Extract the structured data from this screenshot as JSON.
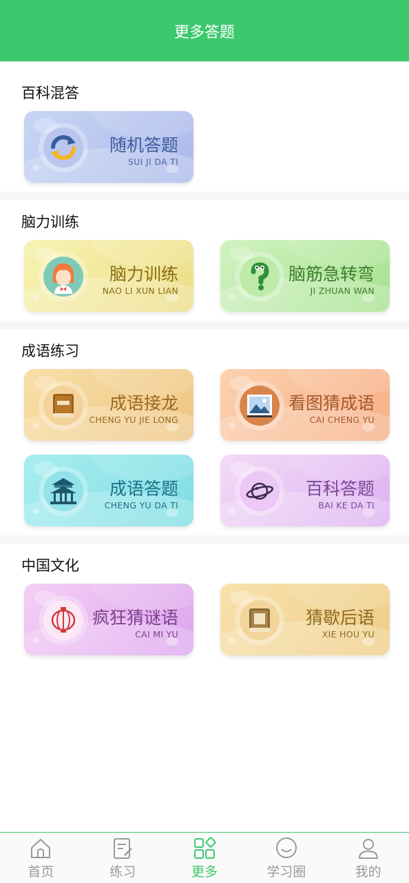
{
  "header": {
    "title": "更多答题"
  },
  "colors": {
    "brand": "#3cc86d",
    "inactive": "#9a9a9a"
  },
  "sections": [
    {
      "title": "百科混答",
      "cards": [
        {
          "title": "随机答题",
          "subtitle": "SUI JI DA TI",
          "icon": "refresh-icon",
          "theme": "blue"
        }
      ]
    },
    {
      "title": "脑力训练",
      "cards": [
        {
          "title": "脑力训练",
          "subtitle": "NAO LI XUN LIAN",
          "icon": "girl-avatar-icon",
          "theme": "yellow"
        },
        {
          "title": "脑筋急转弯",
          "subtitle": "JI ZHUAN WAN",
          "icon": "question-mark-icon",
          "theme": "green"
        }
      ]
    },
    {
      "title": "成语练习",
      "cards": [
        {
          "title": "成语接龙",
          "subtitle": "CHENG YU JIE LONG",
          "icon": "book-icon",
          "theme": "orange"
        },
        {
          "title": "看图猜成语",
          "subtitle": "CAI CHENG YU",
          "icon": "picture-icon",
          "theme": "salmon"
        },
        {
          "title": "成语答题",
          "subtitle": "CHENG YU DA TI",
          "icon": "pavilion-icon",
          "theme": "cyan"
        },
        {
          "title": "百科答题",
          "subtitle": "BAI KE DA TI",
          "icon": "planet-icon",
          "theme": "lavender"
        }
      ]
    },
    {
      "title": "中国文化",
      "cards": [
        {
          "title": "疯狂猜谜语",
          "subtitle": "CAI MI YU",
          "icon": "lantern-icon",
          "theme": "pink"
        },
        {
          "title": "猜歇后语",
          "subtitle": "XIE HOU YU",
          "icon": "xie-book-icon",
          "theme": "gold"
        }
      ]
    }
  ],
  "bottom_nav": [
    {
      "label": "首页",
      "icon": "home-icon",
      "active": false
    },
    {
      "label": "练习",
      "icon": "practice-icon",
      "active": false
    },
    {
      "label": "更多",
      "icon": "more-grid-icon",
      "active": true
    },
    {
      "label": "学习圈",
      "icon": "chat-bubble-icon",
      "active": false
    },
    {
      "label": "我的",
      "icon": "user-icon",
      "active": false
    }
  ]
}
